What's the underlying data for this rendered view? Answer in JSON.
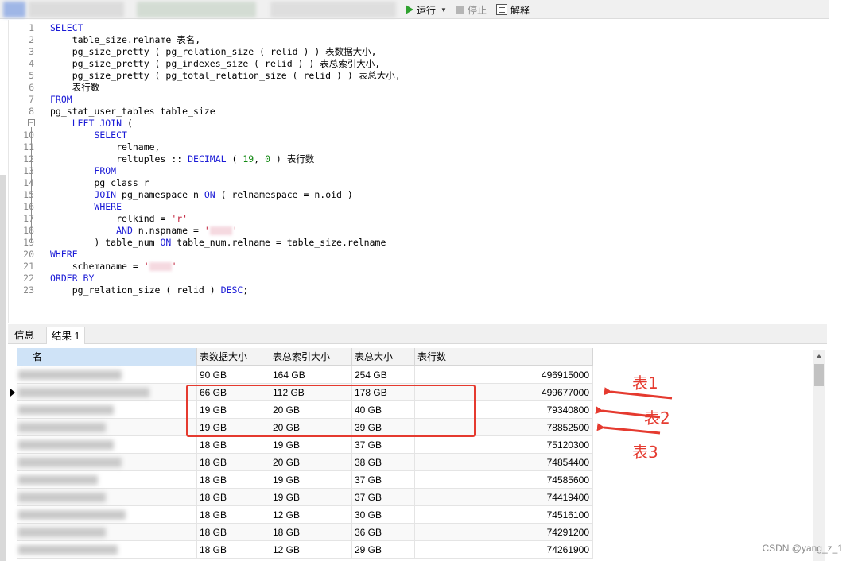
{
  "toolbar": {
    "run_label": "运行",
    "stop_label": "停止",
    "explain_label": "解释"
  },
  "editor": {
    "lines": [
      {
        "n": "1",
        "parts": [
          {
            "t": "SELECT",
            "c": "kw"
          }
        ]
      },
      {
        "n": "2",
        "parts": [
          {
            "t": "    table_size.relname 表名,",
            "c": ""
          }
        ]
      },
      {
        "n": "3",
        "parts": [
          {
            "t": "    pg_size_pretty ( pg_relation_size ( relid ) ) 表数据大小,",
            "c": ""
          }
        ]
      },
      {
        "n": "4",
        "parts": [
          {
            "t": "    pg_size_pretty ( pg_indexes_size ( relid ) ) 表总索引大小,",
            "c": ""
          }
        ]
      },
      {
        "n": "5",
        "parts": [
          {
            "t": "    pg_size_pretty ( pg_total_relation_size ( relid ) ) 表总大小,",
            "c": ""
          }
        ]
      },
      {
        "n": "6",
        "parts": [
          {
            "t": "    表行数",
            "c": ""
          }
        ]
      },
      {
        "n": "7",
        "parts": [
          {
            "t": "FROM",
            "c": "kw"
          }
        ]
      },
      {
        "n": "8",
        "parts": [
          {
            "t": "pg_stat_user_tables table_size",
            "c": ""
          }
        ]
      },
      {
        "n": "9",
        "parts": [
          {
            "t": "    ",
            "c": ""
          },
          {
            "t": "LEFT JOIN",
            "c": "kw"
          },
          {
            "t": " (",
            "c": ""
          }
        ]
      },
      {
        "n": "10",
        "parts": [
          {
            "t": "        ",
            "c": ""
          },
          {
            "t": "SELECT",
            "c": "kw"
          }
        ]
      },
      {
        "n": "11",
        "parts": [
          {
            "t": "            relname,",
            "c": ""
          }
        ]
      },
      {
        "n": "12",
        "parts": [
          {
            "t": "            reltuples :: ",
            "c": ""
          },
          {
            "t": "DECIMAL",
            "c": "kw"
          },
          {
            "t": " ( ",
            "c": ""
          },
          {
            "t": "19",
            "c": "num"
          },
          {
            "t": ", ",
            "c": ""
          },
          {
            "t": "0",
            "c": "num"
          },
          {
            "t": " ) 表行数",
            "c": ""
          }
        ]
      },
      {
        "n": "13",
        "parts": [
          {
            "t": "        ",
            "c": ""
          },
          {
            "t": "FROM",
            "c": "kw"
          }
        ]
      },
      {
        "n": "14",
        "parts": [
          {
            "t": "        pg_class r",
            "c": ""
          }
        ]
      },
      {
        "n": "15",
        "parts": [
          {
            "t": "        ",
            "c": ""
          },
          {
            "t": "JOIN",
            "c": "kw"
          },
          {
            "t": " pg_namespace n ",
            "c": ""
          },
          {
            "t": "ON",
            "c": "kw"
          },
          {
            "t": " ( relnamespace = n.oid )",
            "c": ""
          }
        ]
      },
      {
        "n": "16",
        "parts": [
          {
            "t": "        ",
            "c": ""
          },
          {
            "t": "WHERE",
            "c": "kw"
          }
        ]
      },
      {
        "n": "17",
        "parts": [
          {
            "t": "            relkind = ",
            "c": ""
          },
          {
            "t": "'r'",
            "c": "str"
          }
        ]
      },
      {
        "n": "18",
        "parts": [
          {
            "t": "            ",
            "c": ""
          },
          {
            "t": "AND",
            "c": "kw"
          },
          {
            "t": " n.nspname = ",
            "c": ""
          },
          {
            "t": "'",
            "c": "str"
          },
          {
            "t": "",
            "c": "redact"
          },
          {
            "t": "'",
            "c": "str"
          }
        ]
      },
      {
        "n": "19",
        "parts": [
          {
            "t": "        ) table_num ",
            "c": ""
          },
          {
            "t": "ON",
            "c": "kw"
          },
          {
            "t": " table_num.relname = table_size.relname",
            "c": ""
          }
        ]
      },
      {
        "n": "20",
        "parts": [
          {
            "t": "WHERE",
            "c": "kw"
          }
        ]
      },
      {
        "n": "21",
        "parts": [
          {
            "t": "    schemaname = ",
            "c": ""
          },
          {
            "t": "'",
            "c": "str"
          },
          {
            "t": "",
            "c": "redact"
          },
          {
            "t": "'",
            "c": "str"
          }
        ]
      },
      {
        "n": "22",
        "parts": [
          {
            "t": "ORDER BY",
            "c": "kw"
          }
        ]
      },
      {
        "n": "23",
        "parts": [
          {
            "t": "    pg_relation_size ( relid ) ",
            "c": ""
          },
          {
            "t": "DESC",
            "c": "kw"
          },
          {
            "t": ";",
            "c": ""
          }
        ]
      }
    ]
  },
  "result_tabs": {
    "info": "信息",
    "result1": "结果 1"
  },
  "grid": {
    "columns": [
      "名",
      "表数据大小",
      "表总索引大小",
      "表总大小",
      "表行数"
    ],
    "rows": [
      {
        "data": "90 GB",
        "index": "164 GB",
        "total": "254 GB",
        "rows": "496915000"
      },
      {
        "data": "66 GB",
        "index": "112 GB",
        "total": "178 GB",
        "rows": "499677000"
      },
      {
        "data": "19 GB",
        "index": "20 GB",
        "total": "40 GB",
        "rows": "79340800"
      },
      {
        "data": "19 GB",
        "index": "20 GB",
        "total": "39 GB",
        "rows": "78852500"
      },
      {
        "data": "18 GB",
        "index": "19 GB",
        "total": "37 GB",
        "rows": "75120300"
      },
      {
        "data": "18 GB",
        "index": "20 GB",
        "total": "38 GB",
        "rows": "74854400"
      },
      {
        "data": "18 GB",
        "index": "19 GB",
        "total": "37 GB",
        "rows": "74585600"
      },
      {
        "data": "18 GB",
        "index": "19 GB",
        "total": "37 GB",
        "rows": "74419400"
      },
      {
        "data": "18 GB",
        "index": "12 GB",
        "total": "30 GB",
        "rows": "74516100"
      },
      {
        "data": "18 GB",
        "index": "18 GB",
        "total": "36 GB",
        "rows": "74291200"
      },
      {
        "data": "18 GB",
        "index": "12 GB",
        "total": "29 GB",
        "rows": "74261900"
      }
    ]
  },
  "annotations": {
    "label1": "表1",
    "label2": "表2",
    "label3": "表3",
    "color": "#e53a2f"
  },
  "watermark": "CSDN @yang_z_1"
}
